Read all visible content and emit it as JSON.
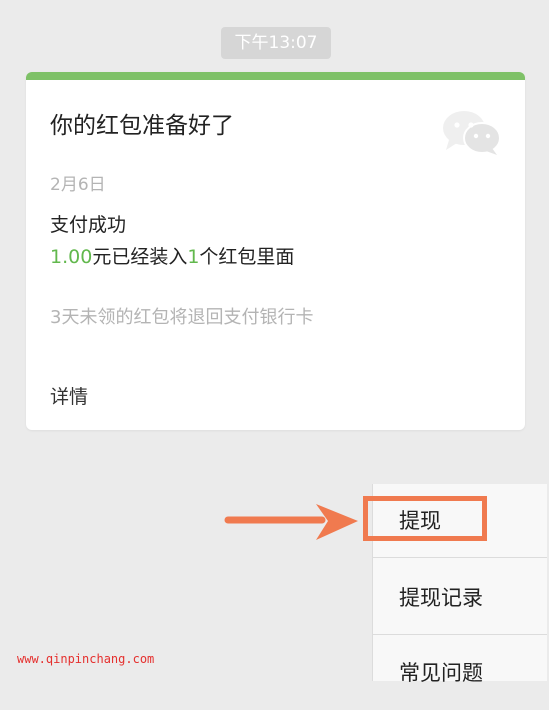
{
  "timestamp": "下午13:07",
  "card": {
    "title": "你的红包准备好了",
    "icon": "wechat-icon",
    "date": "2月6日",
    "status": "支付成功",
    "amount": "1.00",
    "amount_suffix": "元已经装入",
    "count": "1",
    "count_suffix": "个红包里面",
    "refund_note": "3天未领的红包将退回支付银行卡",
    "details_label": "详情",
    "accent_color": "#7ec167",
    "highlight_color": "#62b84d"
  },
  "menu": {
    "items": [
      {
        "label": "提现"
      },
      {
        "label": "提现记录"
      },
      {
        "label": "常见问题"
      }
    ]
  },
  "annotation": {
    "target": "提现",
    "arrow_icon": "arrow-right-icon",
    "color": "#f07a4f"
  },
  "watermark": "www.qinpinchang.com"
}
